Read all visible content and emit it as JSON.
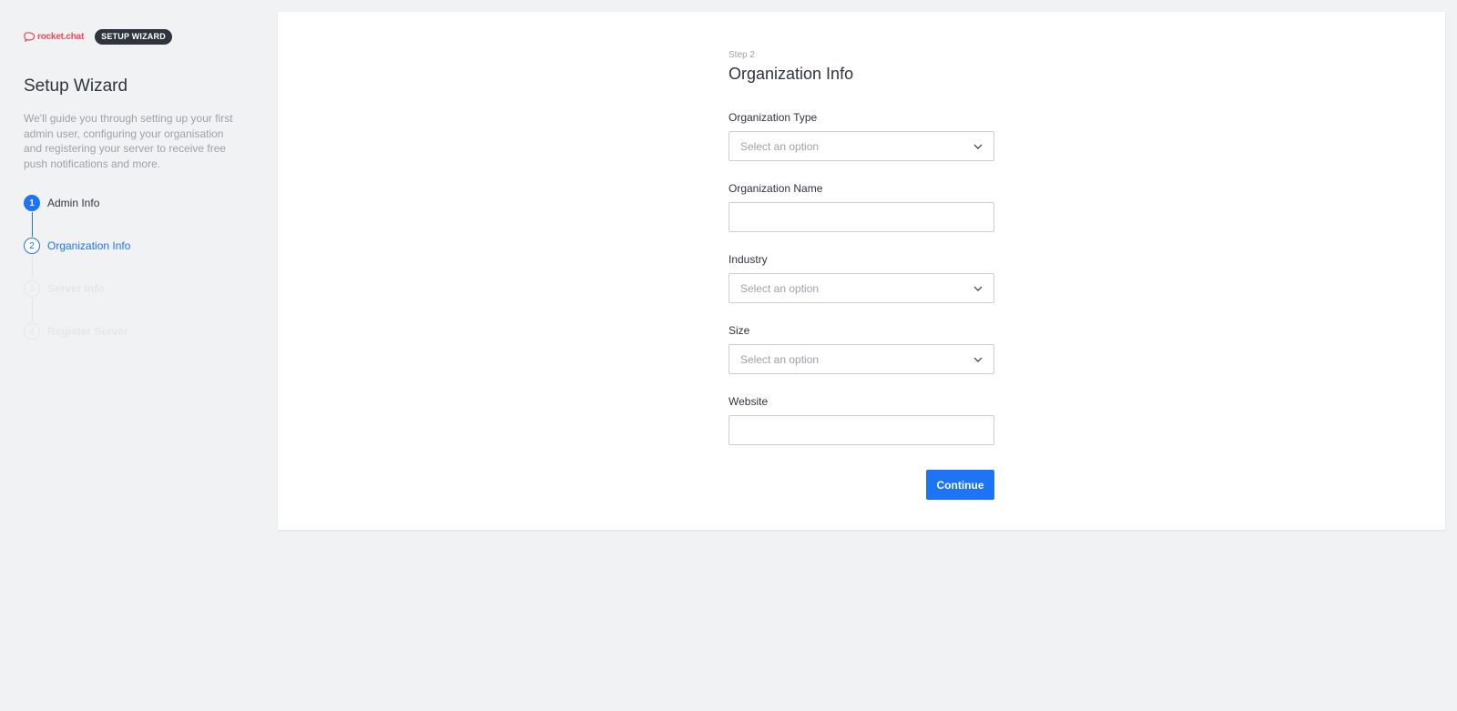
{
  "brand": {
    "name": "rocket.chat",
    "tag": "SETUP WIZARD",
    "color": "#f5455c"
  },
  "sidebar": {
    "title": "Setup Wizard",
    "description": "We'll guide you through setting up your first admin user, configuring your organisation and registering your server to receive free push notifications and more.",
    "steps": [
      {
        "number": "1",
        "label": "Admin Info",
        "state": "done"
      },
      {
        "number": "2",
        "label": "Organization Info",
        "state": "active"
      },
      {
        "number": "3",
        "label": "Server Info",
        "state": "pending"
      },
      {
        "number": "4",
        "label": "Register Server",
        "state": "pending"
      }
    ]
  },
  "form": {
    "step": "Step 2",
    "title": "Organization Info",
    "fields": {
      "org_type": {
        "label": "Organization Type",
        "placeholder": "Select an option"
      },
      "org_name": {
        "label": "Organization Name",
        "value": ""
      },
      "industry": {
        "label": "Industry",
        "placeholder": "Select an option"
      },
      "size": {
        "label": "Size",
        "placeholder": "Select an option"
      },
      "website": {
        "label": "Website",
        "value": ""
      }
    },
    "continue_label": "Continue"
  },
  "colors": {
    "accent": "#1d74f5",
    "background": "#f1f2f4",
    "text": "#2f343d",
    "muted": "#9ea2a8"
  }
}
